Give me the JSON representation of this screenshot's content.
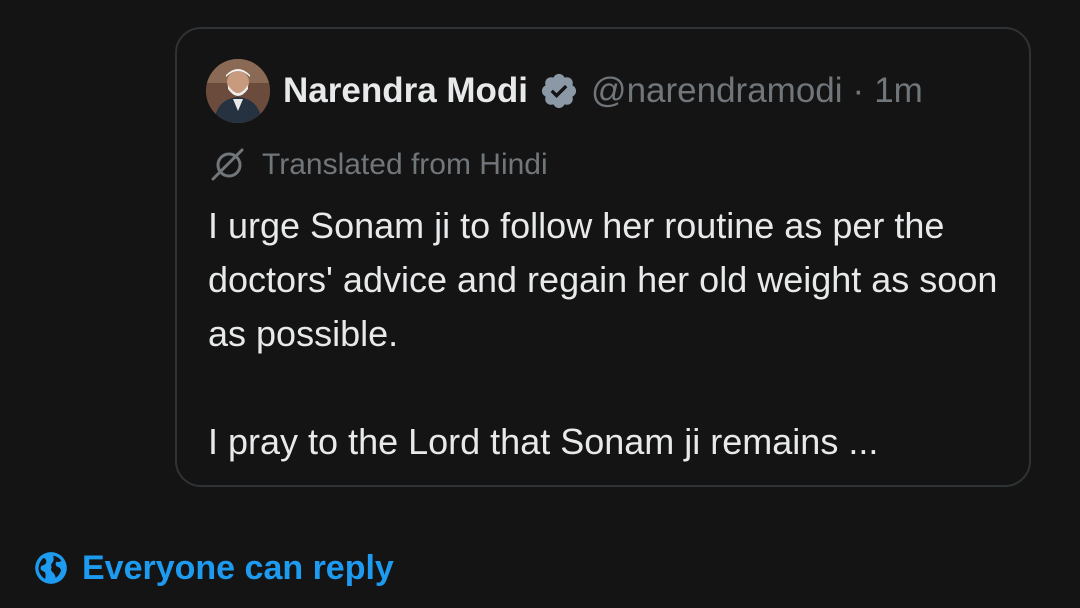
{
  "quoted_post": {
    "author_name": "Narendra Modi",
    "handle": "@narendramodi",
    "separator": "·",
    "time": "1m",
    "avatar_icon": "profile-photo",
    "verified_icon": "verified-badge-icon",
    "translation_label": "Translated from Hindi",
    "translation_icon": "translate-icon",
    "body_paragraphs": [
      "I urge Sonam ji to follow her routine as per the doctors' advice and regain her old weight as soon as possible.",
      "I pray to the Lord that Sonam ji remains ..."
    ]
  },
  "reply_setting": {
    "label": "Everyone can reply",
    "icon": "globe-icon",
    "color": "#1d9bf0"
  },
  "colors": {
    "background": "#141414",
    "text_primary": "#e7e9ea",
    "text_secondary": "#71767b",
    "border": "#2f3336",
    "verified_badge": "#8b98a5",
    "accent": "#1d9bf0"
  }
}
